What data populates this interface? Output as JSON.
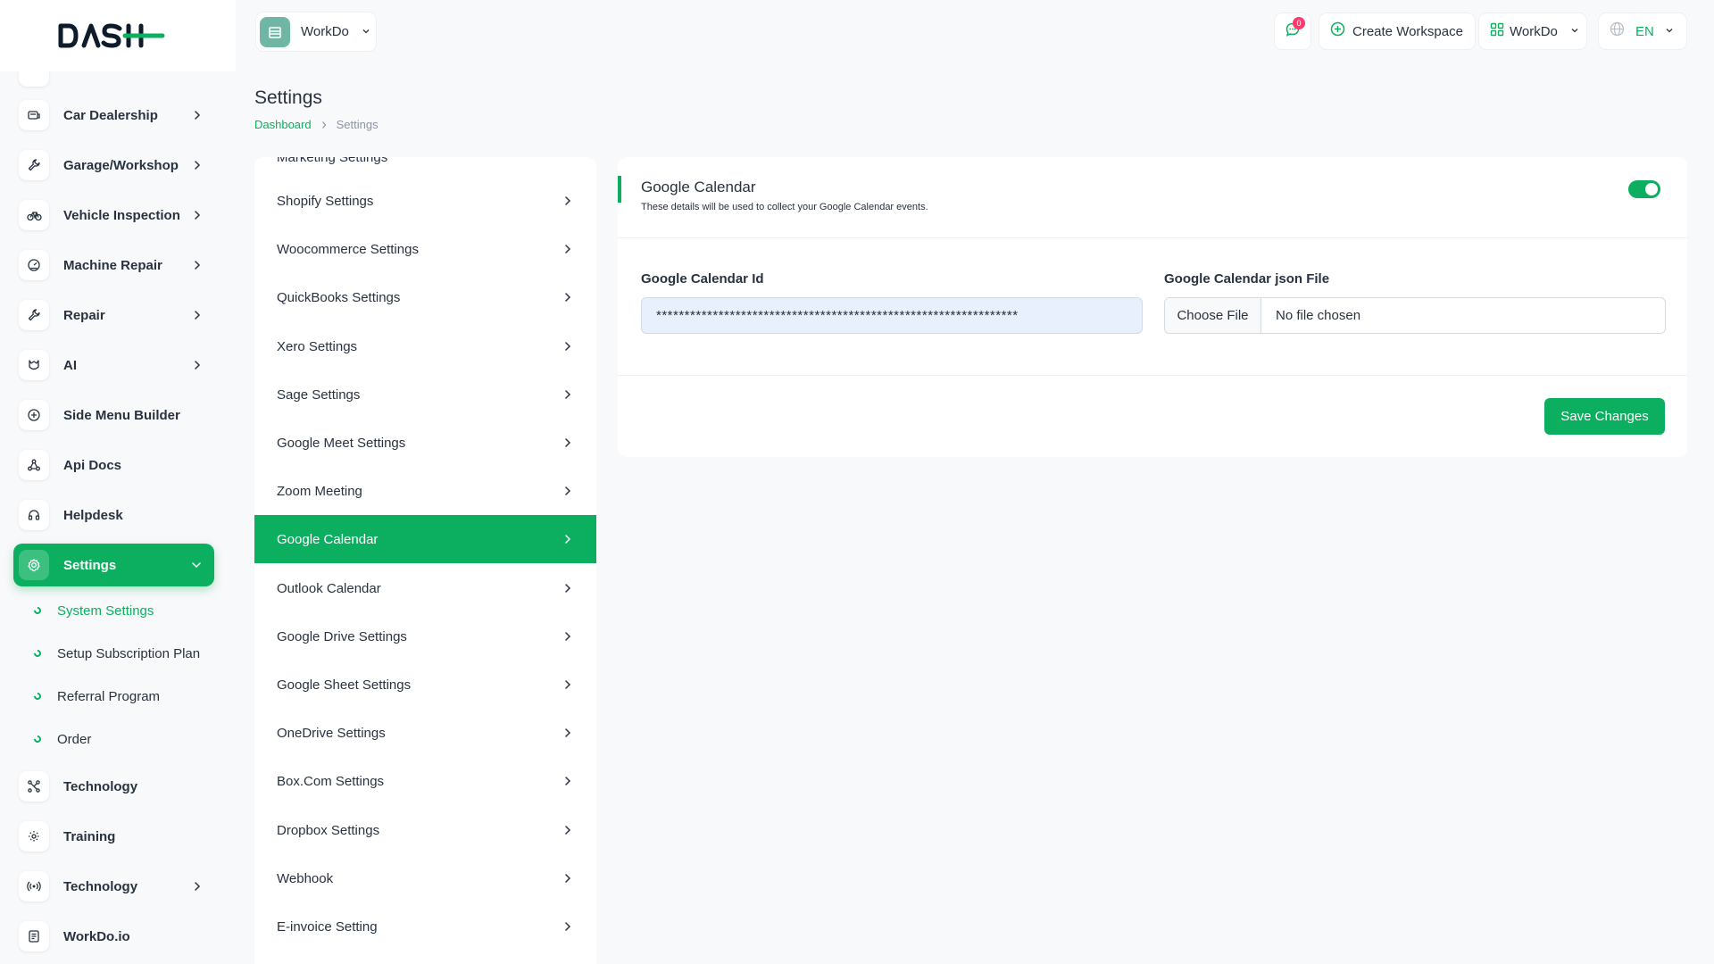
{
  "brand": {
    "logo_text": "DASH",
    "accent": "#0caf60"
  },
  "header": {
    "workspace_switch": {
      "name": "WorkDo"
    },
    "notifications": {
      "count": "0"
    },
    "create_workspace_label": "Create Workspace",
    "workspace_menu_label": "WorkDo",
    "language_label": "EN"
  },
  "sidebar": {
    "items": [
      {
        "label": "Car Dealership",
        "icon": "car-dealership-icon",
        "has_arrow": true
      },
      {
        "label": "Garage/Workshop",
        "icon": "wrench-icon",
        "has_arrow": true
      },
      {
        "label": "Vehicle Inspection",
        "icon": "bicycle-icon",
        "has_arrow": true
      },
      {
        "label": "Machine Repair",
        "icon": "gauge-icon",
        "has_arrow": true
      },
      {
        "label": "Repair",
        "icon": "wrench-icon",
        "has_arrow": true
      },
      {
        "label": "AI",
        "icon": "ai-icon",
        "has_arrow": true
      },
      {
        "label": "Side Menu Builder",
        "icon": "plus-circle-icon",
        "has_arrow": false
      },
      {
        "label": "Api Docs",
        "icon": "api-icon",
        "has_arrow": false
      },
      {
        "label": "Helpdesk",
        "icon": "headset-icon",
        "has_arrow": false
      },
      {
        "label": "Settings",
        "icon": "gear-icon",
        "has_arrow": true,
        "active": true
      }
    ],
    "settings_sub": [
      {
        "label": "System Settings",
        "active": true
      },
      {
        "label": "Setup Subscription Plan"
      },
      {
        "label": "Referral Program"
      },
      {
        "label": "Order"
      }
    ],
    "items_after": [
      {
        "label": "Technology",
        "icon": "network-icon",
        "has_arrow": false
      },
      {
        "label": "Training",
        "icon": "training-icon",
        "has_arrow": false
      },
      {
        "label": "Technology",
        "icon": "broadcast-icon",
        "has_arrow": true
      },
      {
        "label": "WorkDo.io",
        "icon": "document-icon",
        "has_arrow": false
      }
    ]
  },
  "page": {
    "title": "Settings",
    "breadcrumb": {
      "home": "Dashboard",
      "current": "Settings"
    }
  },
  "settings_list": {
    "partial_top": "Marketing Settings",
    "items": [
      "Shopify Settings",
      "Woocommerce Settings",
      "QuickBooks Settings",
      "Xero Settings",
      "Sage Settings",
      "Google Meet Settings",
      "Zoom Meeting",
      "Google Calendar",
      "Outlook Calendar",
      "Google Drive Settings",
      "Google Sheet Settings",
      "OneDrive Settings",
      "Box.Com Settings",
      "Dropbox Settings",
      "Webhook",
      "E-invoice Setting"
    ],
    "active_item": "Google Calendar"
  },
  "card": {
    "title": "Google Calendar",
    "subtitle": "These details will be used to collect your Google Calendar events.",
    "toggle_enabled": true,
    "calendar_id_label": "Google Calendar Id",
    "calendar_id_value": "****************************************************************",
    "json_file_label": "Google Calendar json File",
    "choose_file_label": "Choose File",
    "file_status": "No file chosen",
    "save_label": "Save Changes"
  }
}
